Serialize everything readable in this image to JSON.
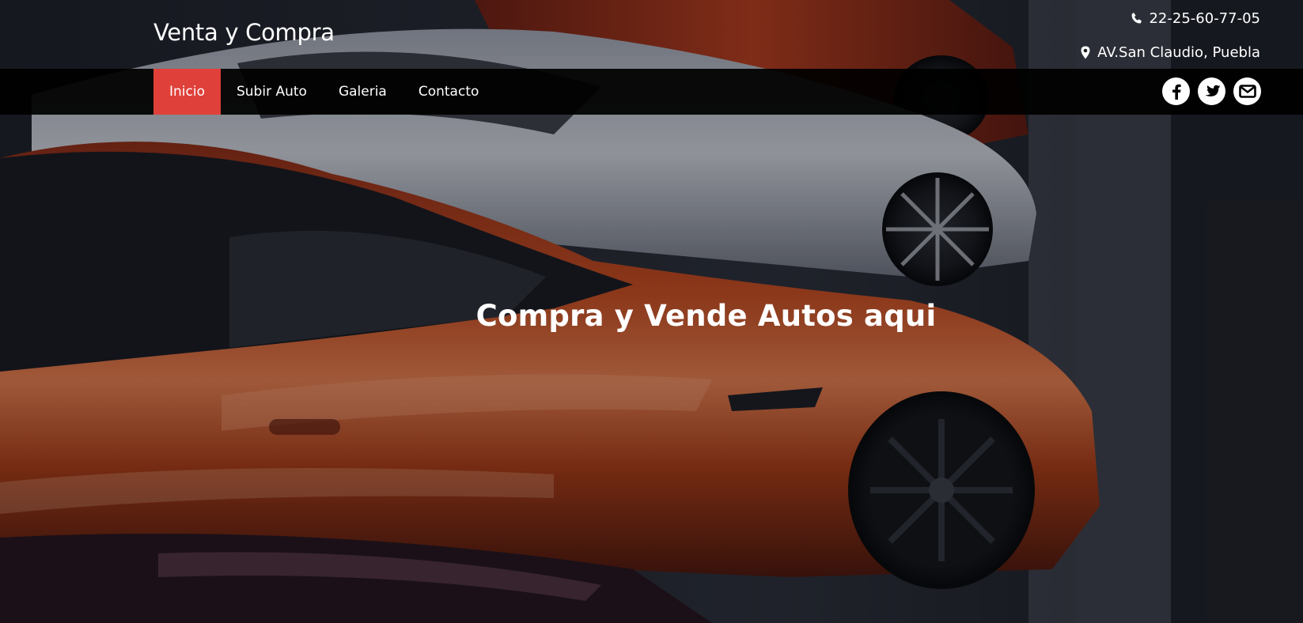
{
  "header": {
    "brand": "Venta y Compra",
    "phone": "22-25-60-77-05",
    "address": "AV.San Claudio, Puebla",
    "phone_icon": "phone-icon",
    "address_icon": "map-marker-icon"
  },
  "nav": {
    "items": [
      {
        "label": "Inicio",
        "active": true
      },
      {
        "label": "Subir Auto",
        "active": false
      },
      {
        "label": "Galeria",
        "active": false
      },
      {
        "label": "Contacto",
        "active": false
      }
    ],
    "active_color": "#e0403a",
    "background": "#000000"
  },
  "social": {
    "icons": [
      "facebook-icon",
      "twitter-icon",
      "envelope-icon"
    ]
  },
  "hero": {
    "title": "Compra y Vende Autos aqui"
  }
}
